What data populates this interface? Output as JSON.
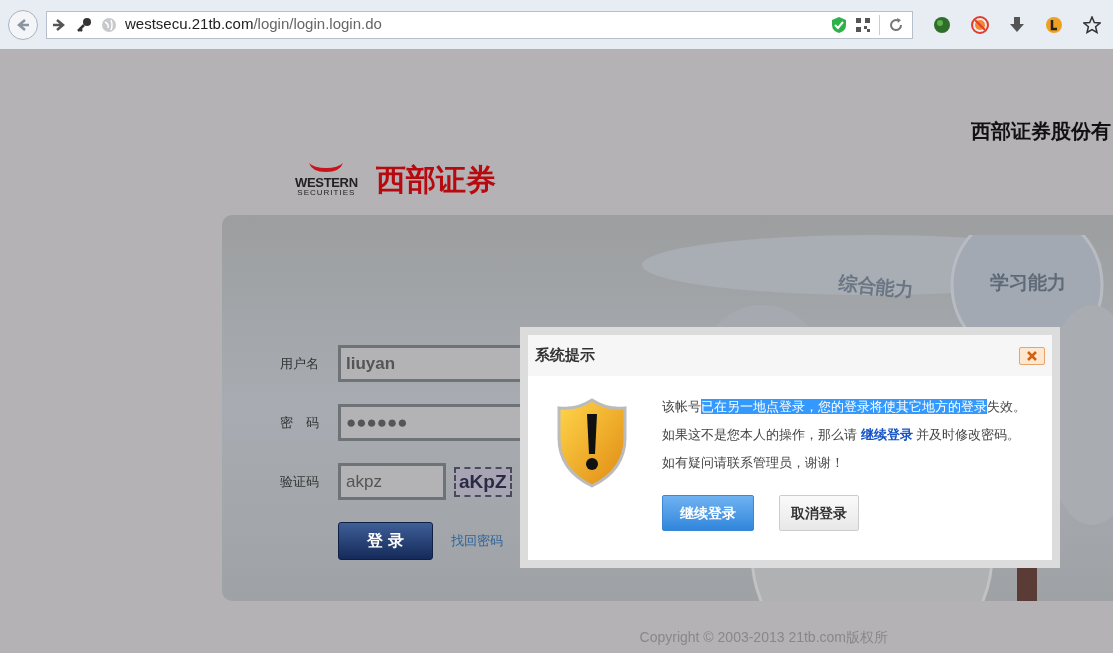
{
  "browser": {
    "url_host": "westsecu.21tb.com",
    "url_path": "/login/login.login.do"
  },
  "header": {
    "logo_word": "WESTERN",
    "logo_sub": "SECURITIES",
    "logo_cn": "西部证券",
    "company": "西部证券股份有"
  },
  "banner": {
    "labels": [
      "综合能力",
      "学习能力"
    ]
  },
  "login": {
    "fields": [
      {
        "label": "用户名",
        "value": "liuyan",
        "kind": "text"
      },
      {
        "label": "密　码",
        "value": "●●●●●●",
        "kind": "password"
      },
      {
        "label": "验证码",
        "value": "akpz",
        "kind": "captcha",
        "captcha": "aKpZ"
      }
    ],
    "submit": "登 录",
    "forgot": "找回密码"
  },
  "dialog": {
    "title": "系统提示",
    "lines": [
      [
        {
          "text": "该帐号",
          "selected": false
        },
        {
          "text": "已在另一地点登录，您的登录将使其它地方的登录",
          "selected": true
        },
        {
          "text": "失效。",
          "selected": false
        }
      ],
      [
        {
          "text": "如果这不是您本人的操作，那么请 ",
          "kind": "plain"
        },
        {
          "text": "继续登录",
          "kind": "link"
        },
        {
          "text": " 并及时修改密码。",
          "kind": "plain"
        }
      ],
      [
        {
          "text": "如有疑问请联系管理员，谢谢！",
          "kind": "plain"
        }
      ]
    ],
    "buttons": [
      {
        "label": "继续登录",
        "primary": true
      },
      {
        "label": "取消登录",
        "primary": false
      }
    ]
  },
  "footer": {
    "copyright": "Copyright © 2003-2013 21tb.com版权所"
  }
}
